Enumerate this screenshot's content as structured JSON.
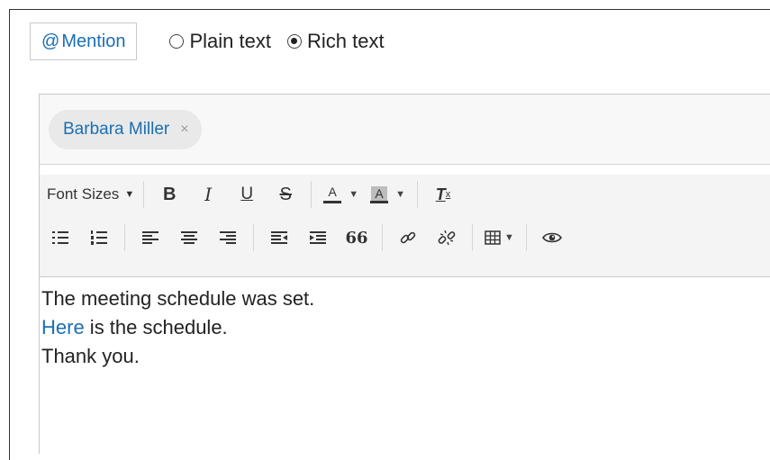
{
  "mention_button": {
    "at": "@",
    "label": "Mention"
  },
  "format_options": [
    {
      "label": "Plain text",
      "selected": false
    },
    {
      "label": "Rich text",
      "selected": true
    }
  ],
  "mentions": [
    {
      "name": "Barbara Miller",
      "remove_symbol": "×"
    }
  ],
  "toolbar": {
    "font_sizes_label": "Font Sizes",
    "caret": "▼",
    "bold": "B",
    "italic": "I",
    "underline": "U",
    "strikethrough": "S",
    "text_color": "A",
    "background_color": "A",
    "remove_format": "T",
    "remove_format_sub": "x",
    "blockquote": "66"
  },
  "content": {
    "line1": "The meeting schedule was set.",
    "link_text": "Here",
    "line2_rest": " is the schedule.",
    "line3": "Thank you."
  },
  "colors": {
    "link": "#1a6fb3",
    "toolbar_bg": "#f4f4f4",
    "chip_bg": "#e9e9e9",
    "border": "#c8c8c8"
  }
}
